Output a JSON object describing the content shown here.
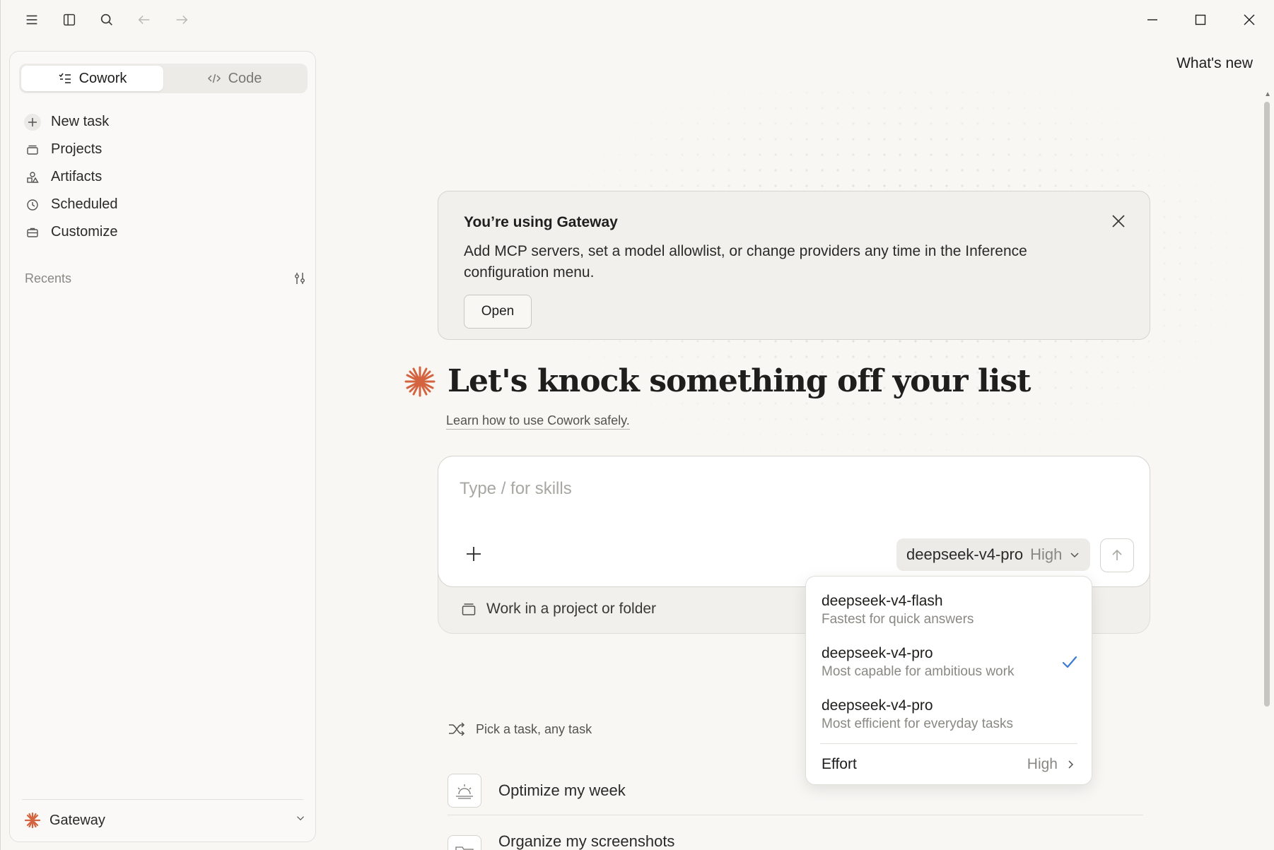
{
  "window": {
    "whats_new": "What's new"
  },
  "sidebar": {
    "modes": [
      {
        "label": "Cowork",
        "active": true
      },
      {
        "label": "Code",
        "active": false
      }
    ],
    "nav": [
      {
        "label": "New task",
        "icon": "plus-icon"
      },
      {
        "label": "Projects",
        "icon": "folder-icon"
      },
      {
        "label": "Artifacts",
        "icon": "shapes-icon"
      },
      {
        "label": "Scheduled",
        "icon": "clock-icon"
      },
      {
        "label": "Customize",
        "icon": "briefcase-icon"
      }
    ],
    "recents_label": "Recents",
    "footer": {
      "label": "Gateway"
    }
  },
  "notice": {
    "title": "You’re using Gateway",
    "body": "Add MCP servers, set a model allowlist, or change providers any time in the Inference configuration menu.",
    "open_label": "Open"
  },
  "main": {
    "headline": "Let's knock something off your list",
    "learn_link": "Learn how to use Cowork safely.",
    "composer": {
      "placeholder": "Type / for skills",
      "model": "deepseek-v4-pro",
      "effort": "High",
      "project_label": "Work in a project or folder"
    },
    "pick_label": "Pick a task, any task",
    "tasks": [
      {
        "label": "Optimize my week"
      },
      {
        "label": "Organize my screenshots"
      }
    ]
  },
  "dropdown": {
    "items": [
      {
        "name": "deepseek-v4-flash",
        "desc": "Fastest for quick answers",
        "selected": false
      },
      {
        "name": "deepseek-v4-pro",
        "desc": "Most capable for ambitious work",
        "selected": true
      },
      {
        "name": "deepseek-v4-pro",
        "desc": "Most efficient for everyday tasks",
        "selected": false
      }
    ],
    "effort_label": "Effort",
    "effort_value": "High"
  },
  "colors": {
    "accent_orange": "#d4643f",
    "check_blue": "#3a7bd5",
    "background": "#f8f7f4"
  }
}
